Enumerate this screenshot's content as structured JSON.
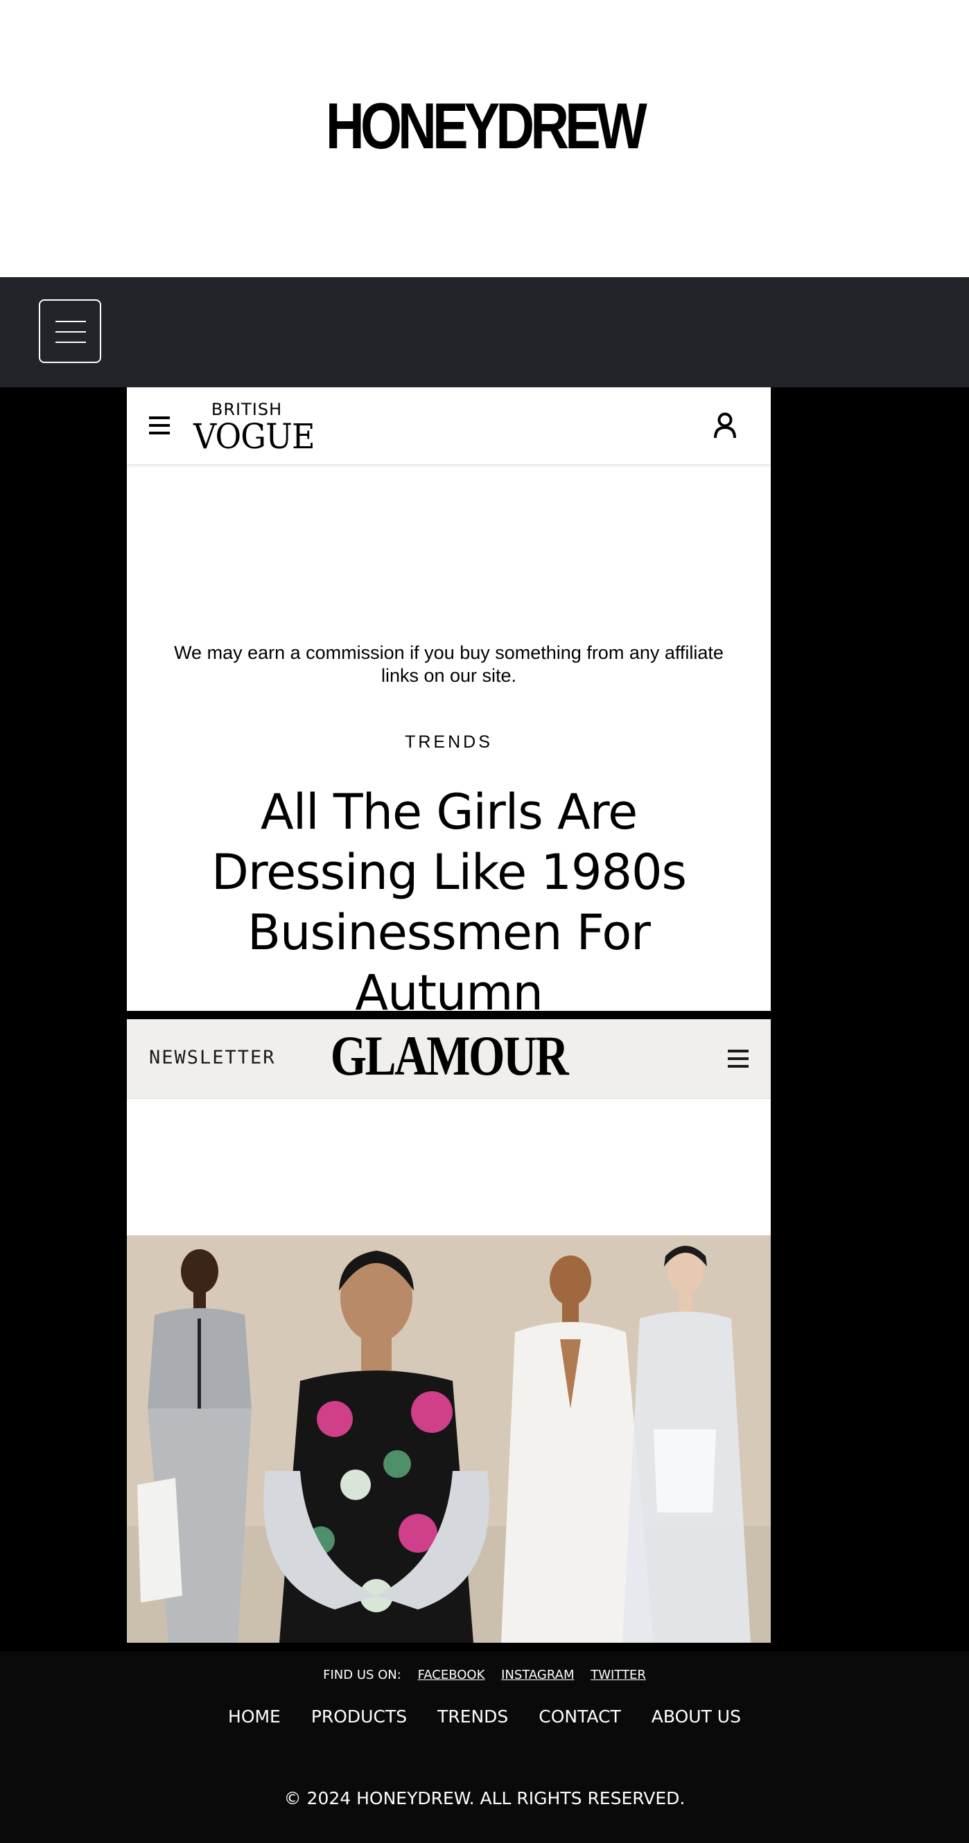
{
  "site": {
    "logo": "HONEYDREW"
  },
  "vogue": {
    "logo_top": "BRITISH",
    "logo_bottom": "VOGUE",
    "disclaimer": "We may earn a commission if you buy something from any affiliate links on our site.",
    "rubric": "TRENDS",
    "headline": "All The Girls Are Dressing Like 1980s Businessmen For Autumn"
  },
  "glamour": {
    "newsletter_label": "NEWSLETTER",
    "logo": "GLAMOUR"
  },
  "footer": {
    "find_us": "FIND US ON:",
    "social": [
      "FACEBOOK",
      "INSTAGRAM",
      "TWITTER"
    ],
    "nav": [
      "HOME",
      "PRODUCTS",
      "TRENDS",
      "CONTACT",
      "ABOUT US"
    ],
    "copyright": "© 2024 HONEYDREW. ALL RIGHTS RESERVED."
  },
  "colors": {
    "nav_bg": "#212529",
    "footer_bg": "#0a0a0a",
    "glamour_bar_bg": "#f0efeb"
  },
  "icons": {
    "nav_toggler": "menu-icon",
    "vogue_menu": "menu-icon",
    "vogue_account": "user-icon",
    "glamour_menu": "menu-icon"
  }
}
